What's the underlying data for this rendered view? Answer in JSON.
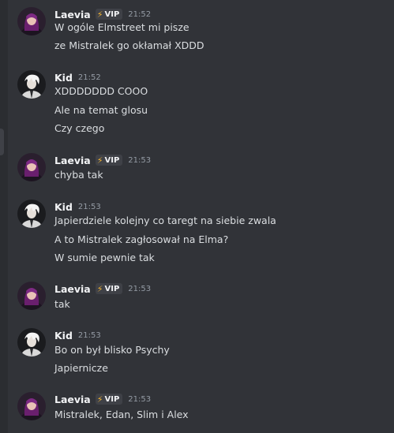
{
  "badge_label": "VIP",
  "colors": {
    "background": "#313338",
    "username": "#f2f3f5",
    "message_text": "#dbdee1",
    "timestamp": "#949ba4",
    "badge_bg": "#3f4147",
    "bolt": "#f0b232"
  },
  "messages": [
    {
      "author": "Laevia",
      "vip": true,
      "time": "21:52",
      "lines": [
        "W ogóle Elmstreet mi pisze",
        "ze Mistralek go okłamał XDDD"
      ]
    },
    {
      "author": "Kid",
      "vip": false,
      "time": "21:52",
      "lines": [
        "XDDDDDDD COOO",
        "Ale na temat glosu",
        "Czy czego"
      ]
    },
    {
      "author": "Laevia",
      "vip": true,
      "time": "21:53",
      "lines": [
        "chyba tak"
      ]
    },
    {
      "author": "Kid",
      "vip": false,
      "time": "21:53",
      "lines": [
        "Japierdziele kolejny co taregt na siebie zwala",
        "A to Mistralek zagłosował na Elma?",
        "W sumie pewnie tak"
      ]
    },
    {
      "author": "Laevia",
      "vip": true,
      "time": "21:53",
      "lines": [
        "tak"
      ]
    },
    {
      "author": "Kid",
      "vip": false,
      "time": "21:53",
      "lines": [
        "Bo on był blisko Psychy",
        "Japierniczе"
      ]
    },
    {
      "author": "Laevia",
      "vip": true,
      "time": "21:53",
      "lines": [
        "Mistralek, Edan, Slim i Alex"
      ]
    }
  ]
}
